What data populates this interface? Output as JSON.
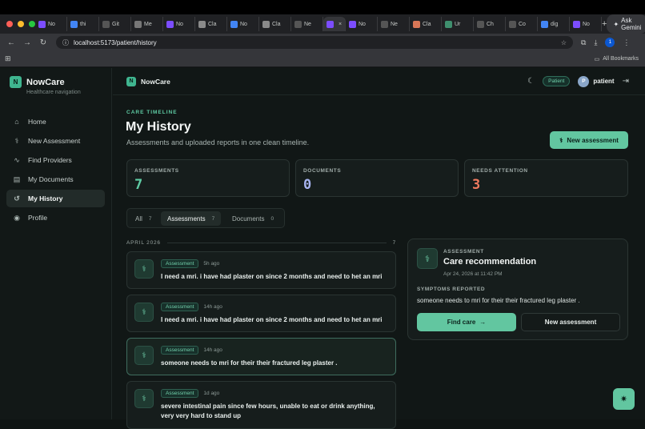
{
  "browser": {
    "window_dots": [
      "#ff5f57",
      "#febc2e",
      "#28c840"
    ],
    "tabs": [
      {
        "label": "No",
        "icon": "nowcare-favicon",
        "color": "#7c4dff",
        "active": false
      },
      {
        "label": "thi",
        "icon": "docs-favicon",
        "color": "#4285f4",
        "active": false
      },
      {
        "label": "Git",
        "icon": "chatgpt-favicon",
        "color": "#555555",
        "active": false
      },
      {
        "label": "Me",
        "icon": "help-favicon",
        "color": "#777777",
        "active": false
      },
      {
        "label": "No",
        "icon": "nowcare-favicon",
        "color": "#7c4dff",
        "active": false
      },
      {
        "label": "Cla",
        "icon": "claude-favicon",
        "color": "#8a8a8a",
        "active": false
      },
      {
        "label": "No",
        "icon": "docs-favicon",
        "color": "#4285f4",
        "active": false
      },
      {
        "label": "Cla",
        "icon": "claude-favicon",
        "color": "#8a8a8a",
        "active": false
      },
      {
        "label": "Ne",
        "icon": "chatgpt-favicon",
        "color": "#555555",
        "active": false
      },
      {
        "label": "",
        "icon": "nowcare-favicon",
        "color": "#7c4dff",
        "active": true
      },
      {
        "label": "No",
        "icon": "nowcare-favicon",
        "color": "#7c4dff",
        "active": false
      },
      {
        "label": "Ne",
        "icon": "chatgpt-favicon",
        "color": "#555555",
        "active": false
      },
      {
        "label": "Cla",
        "icon": "claude-favicon",
        "color": "#d97757",
        "active": false
      },
      {
        "label": "Ur",
        "icon": "perplexity-favicon",
        "color": "#3f8f6e",
        "active": false
      },
      {
        "label": "Ch",
        "icon": "chatgpt-favicon",
        "color": "#555555",
        "active": false
      },
      {
        "label": "Co",
        "icon": "chatgpt-favicon",
        "color": "#555555",
        "active": false
      },
      {
        "label": "dig",
        "icon": "google-favicon",
        "color": "#4285f4",
        "active": false
      },
      {
        "label": "No",
        "icon": "nowcare-favicon",
        "color": "#7c4dff",
        "active": false
      }
    ],
    "new_tab": "+",
    "ask_gemini": "Ask Gemini",
    "url": "localhost:5173/patient/history",
    "profile_initial": "1",
    "all_bookmarks": "All Bookmarks"
  },
  "sidebar": {
    "brand_initial": "N",
    "brand": "NowCare",
    "subtitle": "Healthcare navigation",
    "items": [
      {
        "label": "Home",
        "icon": "home-icon",
        "glyph": "⌂",
        "active": false
      },
      {
        "label": "New Assessment",
        "icon": "stethoscope-icon",
        "glyph": "⚕",
        "active": false
      },
      {
        "label": "Find Providers",
        "icon": "activity-icon",
        "glyph": "∿",
        "active": false
      },
      {
        "label": "My Documents",
        "icon": "document-icon",
        "glyph": "▤",
        "active": false
      },
      {
        "label": "My History",
        "icon": "history-icon",
        "glyph": "↺",
        "active": true
      },
      {
        "label": "Profile",
        "icon": "profile-icon",
        "glyph": "◉",
        "active": false
      }
    ]
  },
  "header": {
    "brand_initial": "N",
    "brand": "NowCare",
    "role": "Patient",
    "avatar_initial": "P",
    "username": "patient"
  },
  "page": {
    "eyebrow": "CARE TIMELINE",
    "title": "My History",
    "subtitle": "Assessments and uploaded reports in one clean timeline.",
    "new_assessment": "New assessment"
  },
  "stats": [
    {
      "label": "ASSESSMENTS",
      "value": "7",
      "color": "#5fcca4"
    },
    {
      "label": "DOCUMENTS",
      "value": "0",
      "color": "#a8b4f0"
    },
    {
      "label": "NEEDS ATTENTION",
      "value": "3",
      "color": "#f07a5f"
    }
  ],
  "filters": [
    {
      "label": "All",
      "count": "7",
      "active": false
    },
    {
      "label": "Assessments",
      "count": "7",
      "active": true
    },
    {
      "label": "Documents",
      "count": "0",
      "active": false
    }
  ],
  "timeline": {
    "month": "APRIL 2026",
    "month_count": "7",
    "entries": [
      {
        "type": "Assessment",
        "time": "5h ago",
        "text": "I need a mri. i have had plaster on since 2 months and need to het an mri",
        "selected": false
      },
      {
        "type": "Assessment",
        "time": "14h ago",
        "text": "I need a mri. i have had plaster on since 2 months and need to het an mri",
        "selected": false
      },
      {
        "type": "Assessment",
        "time": "14h ago",
        "text": "someone needs to mri for their their fractured leg plaster .",
        "selected": true
      },
      {
        "type": "Assessment",
        "time": "1d ago",
        "text": "severe intestinal pain since few hours, unable to eat or drink anything, very very hard to stand up",
        "selected": false
      }
    ]
  },
  "detail": {
    "eyebrow": "ASSESSMENT",
    "title": "Care recommendation",
    "date": "Apr 24, 2026 at 11:42 PM",
    "symptoms_label": "SYMPTOMS REPORTED",
    "symptoms": "someone needs to mri for their their fractured leg plaster .",
    "find_care": "Find care",
    "new_assessment": "New assessment"
  },
  "colors": {
    "accent": "#62c6a0",
    "background": "#111716"
  }
}
